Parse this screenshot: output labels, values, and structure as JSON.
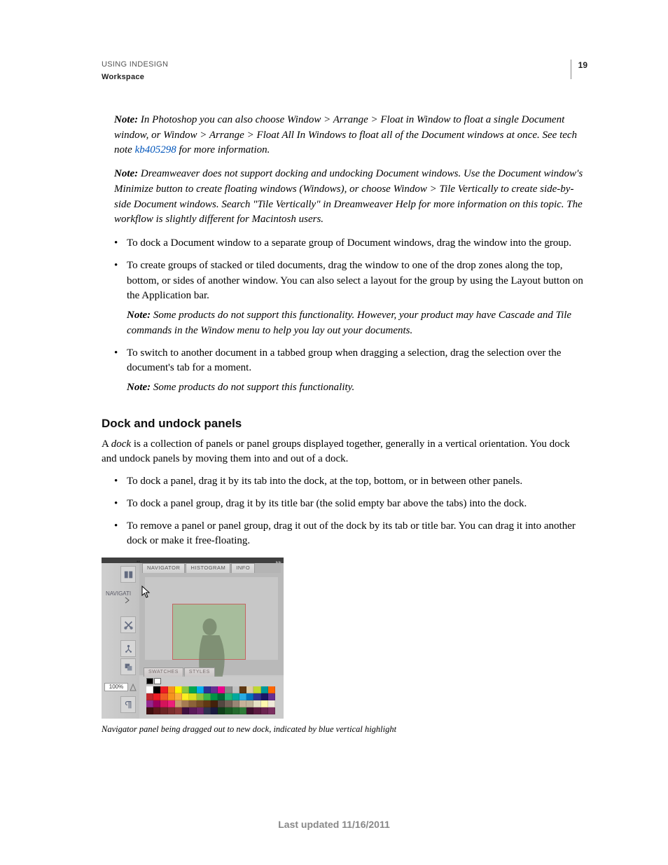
{
  "header": {
    "title": "USING INDESIGN",
    "section": "Workspace",
    "page_number": "19"
  },
  "notes": {
    "n1_label": "Note: ",
    "n1_a": "In Photoshop you can also choose Window > Arrange > Float in Window to float a single Document window, or Window > Arrange > Float All In Windows to float all of the Document windows at once. See tech note ",
    "n1_link": "kb405298",
    "n1_b": " for more information.",
    "n2_label": "Note:  ",
    "n2": "Dreamweaver does not support docking and undocking Document windows. Use the Document window's Minimize button to create floating windows (Windows), or choose Window > Tile Vertically to create side-by-side Document windows. Search \"Tile Vertically\" in Dreamweaver Help for more information on this topic. The workflow is slightly different for Macintosh users."
  },
  "list1": {
    "i1": "To dock a Document window to a separate group of Document windows, drag the window into the group.",
    "i2": "To create groups of stacked or tiled documents, drag the window to one of the drop zones along the top, bottom, or sides of another window. You can also select a layout for the group by using the Layout button on the Application bar.",
    "i2_note_label": "Note:  ",
    "i2_note": "Some products do not support this functionality. However, your product may have Cascade and Tile commands in the Window menu to help you lay out your documents.",
    "i3": "To switch to another document in a tabbed group when dragging a selection, drag the selection over the document's tab for a moment.",
    "i3_note_label": "Note:  ",
    "i3_note": "Some products do not support this functionality."
  },
  "section2": {
    "heading": "Dock and undock panels",
    "p_a": "A ",
    "p_term": "dock",
    "p_b": " is a collection of panels or panel groups displayed together, generally in a vertical orientation. You dock and undock panels by moving them into and out of a dock."
  },
  "list2": {
    "i1": "To dock a panel, drag it by its tab into the dock, at the top, bottom, or in between other panels.",
    "i2": "To dock a panel group, drag it by its title bar (the solid empty bar above the tabs) into the dock.",
    "i3": "To remove a panel or panel group, drag it out of the dock by its tab or title bar. You can drag it into another dock or make it free-floating."
  },
  "figure": {
    "tabs": {
      "navigator": "NAVIGATOR",
      "histogram": "HISTOGRAM",
      "info": "INFO"
    },
    "nav_tag": "NAVIGATI",
    "zoom": "100%",
    "bottom_tabs": {
      "swatches": "SWATCHES",
      "styles": "STYLES"
    },
    "caption": "Navigator panel being dragged out to new dock, indicated by blue vertical highlight"
  },
  "footer": "Last updated 11/16/2011",
  "swatch_colors": [
    "#ffffff",
    "#000000",
    "#ec1c24",
    "#f7931e",
    "#fff200",
    "#8cc63f",
    "#00a651",
    "#00aeef",
    "#2e3192",
    "#662d91",
    "#ec008c",
    "#898989",
    "#c0c0c0",
    "#603913",
    "#decba5",
    "#BFD730",
    "#009999",
    "#ff6600",
    "#c1272d",
    "#ed1c24",
    "#f15a24",
    "#f7931e",
    "#fbb03b",
    "#fcee21",
    "#d9e021",
    "#8cc63f",
    "#39b54a",
    "#009245",
    "#006837",
    "#22b573",
    "#00a99d",
    "#29abe2",
    "#0071bc",
    "#2e3192",
    "#1b1464",
    "#662d91",
    "#93278f",
    "#9e005d",
    "#d4145a",
    "#ed1e79",
    "#c69c6d",
    "#a67c52",
    "#8c6239",
    "#754c24",
    "#603813",
    "#42210b",
    "#534741",
    "#736357",
    "#998675",
    "#c7b299",
    "#c2b59b",
    "#e6e1c5",
    "#fff9ae",
    "#f0eada",
    "#401010",
    "#5b1a1a",
    "#6b2424",
    "#7b2e2e",
    "#8b3838",
    "#401040",
    "#5b1a5b",
    "#6b246b",
    "#2e3150",
    "#1a1a40",
    "#10401a",
    "#1a5b24",
    "#246b2e",
    "#2e7b38",
    "#40102e",
    "#5b1a40",
    "#6b2450",
    "#7b2e60"
  ]
}
